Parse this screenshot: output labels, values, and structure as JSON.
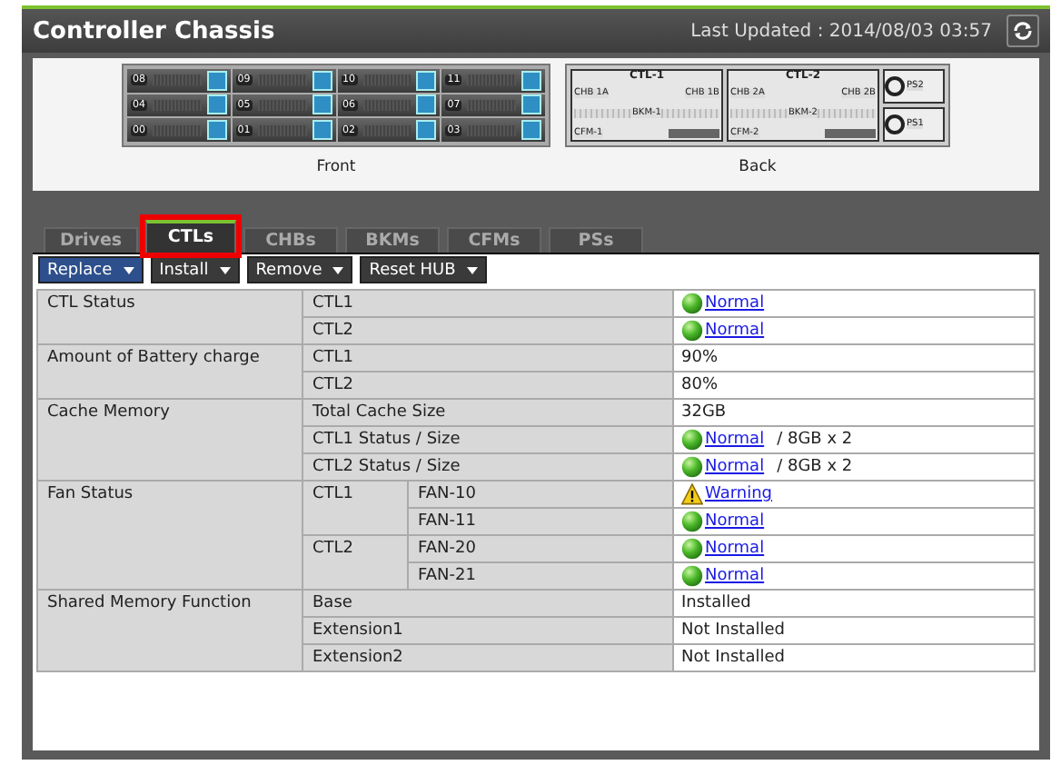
{
  "window": {
    "title": "Controller Chassis",
    "last_updated": "Last Updated : 2014/08/03 03:57"
  },
  "chassis": {
    "front": {
      "caption": "Front",
      "bays": [
        "08",
        "09",
        "10",
        "11",
        "04",
        "05",
        "06",
        "07",
        "00",
        "01",
        "02",
        "03"
      ]
    },
    "back": {
      "caption": "Back",
      "controllers": [
        {
          "name": "CTL-1",
          "chb_a": "CHB 1A",
          "chb_b": "CHB 1B",
          "bkm": "BKM-1",
          "cfm": "CFM-1"
        },
        {
          "name": "CTL-2",
          "chb_a": "CHB 2A",
          "chb_b": "CHB 2B",
          "bkm": "BKM-2",
          "cfm": "CFM-2"
        }
      ],
      "power_supplies": [
        "PS2",
        "PS1"
      ]
    }
  },
  "tabs": [
    {
      "label": "Drives",
      "selected": false,
      "highlighted": false
    },
    {
      "label": "CTLs",
      "selected": true,
      "highlighted": true
    },
    {
      "label": "CHBs",
      "selected": false,
      "highlighted": false
    },
    {
      "label": "BKMs",
      "selected": false,
      "highlighted": false
    },
    {
      "label": "CFMs",
      "selected": false,
      "highlighted": false
    },
    {
      "label": "PSs",
      "selected": false,
      "highlighted": false
    }
  ],
  "toolbar": [
    {
      "label": "Replace",
      "active": true
    },
    {
      "label": "Install",
      "active": false
    },
    {
      "label": "Remove",
      "active": false
    },
    {
      "label": "Reset HUB",
      "active": false
    }
  ],
  "table": {
    "groups": [
      {
        "label": "CTL Status",
        "rows": [
          {
            "item": "CTL1",
            "value": {
              "kind": "normal",
              "text": "Normal"
            }
          },
          {
            "item": "CTL2",
            "value": {
              "kind": "normal",
              "text": "Normal"
            }
          }
        ]
      },
      {
        "label": "Amount of Battery charge",
        "rows": [
          {
            "item": "CTL1",
            "value": {
              "text": "90%"
            }
          },
          {
            "item": "CTL2",
            "value": {
              "text": "80%"
            }
          }
        ]
      },
      {
        "label": "Cache Memory",
        "rows": [
          {
            "item": "Total Cache Size",
            "value": {
              "text": "32GB"
            }
          },
          {
            "item": "CTL1 Status / Size",
            "value": {
              "kind": "normal",
              "text": "Normal",
              "suffix": "/ 8GB x 2"
            }
          },
          {
            "item": "CTL2 Status / Size",
            "value": {
              "kind": "normal",
              "text": "Normal",
              "suffix": "/ 8GB x 2"
            }
          }
        ]
      },
      {
        "label": "Fan Status",
        "subgroups": [
          {
            "item": "CTL1",
            "rows": [
              {
                "item": "FAN-10",
                "value": {
                  "kind": "warning",
                  "text": "Warning"
                }
              },
              {
                "item": "FAN-11",
                "value": {
                  "kind": "normal",
                  "text": "Normal"
                }
              }
            ]
          },
          {
            "item": "CTL2",
            "rows": [
              {
                "item": "FAN-20",
                "value": {
                  "kind": "normal",
                  "text": "Normal"
                }
              },
              {
                "item": "FAN-21",
                "value": {
                  "kind": "normal",
                  "text": "Normal"
                }
              }
            ]
          }
        ]
      },
      {
        "label": "Shared Memory Function",
        "rows": [
          {
            "item": "Base",
            "value": {
              "text": "Installed"
            }
          },
          {
            "item": "Extension1",
            "value": {
              "text": "Not Installed"
            }
          },
          {
            "item": "Extension2",
            "value": {
              "text": "Not Installed"
            }
          }
        ]
      }
    ]
  }
}
